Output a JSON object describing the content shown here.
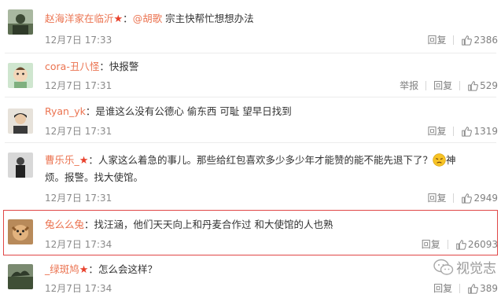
{
  "actions": {
    "reply": "回复",
    "report": "举报"
  },
  "watermark": {
    "text": "视觉志"
  },
  "comments": [
    {
      "user": "赵海洋家在临沂",
      "has_star": true,
      "sep": "：",
      "mention": "@胡歌",
      "text": " 宗主快帮忙想想办法",
      "time": "12月7日 17:33",
      "likes": "2386"
    },
    {
      "user": "cora-丑八怪",
      "sep": "：",
      "text": "快报警",
      "time": "12月7日 17:31",
      "likes": "529"
    },
    {
      "user": "Ryan_yk",
      "sep": "：",
      "text": "是谁这么没有公德心 偷东西 可耻 望早日找到",
      "time": "12月7日 17:31",
      "likes": "1319"
    },
    {
      "user": "曹乐乐_",
      "has_star": true,
      "sep": "：",
      "text": "人家这么着急的事儿。那些给红包喜欢多少多少年才能赞的能不能先退下了？",
      "text_after_emoji": "神",
      "text2": "烦。报警。找大使馆。",
      "time": "12月7日 17:31",
      "likes": "2949"
    },
    {
      "user": "兔么么兔",
      "sep": "：",
      "text": "找汪涵，他们天天向上和丹麦合作过 和大使馆的人也熟",
      "time": "12月7日 17:34",
      "likes": "26093"
    },
    {
      "user": "_绿斑鸠",
      "has_star": true,
      "sep": "：",
      "text": "怎么会这样？",
      "time": "12月7日 17:34",
      "likes": "389"
    }
  ]
}
